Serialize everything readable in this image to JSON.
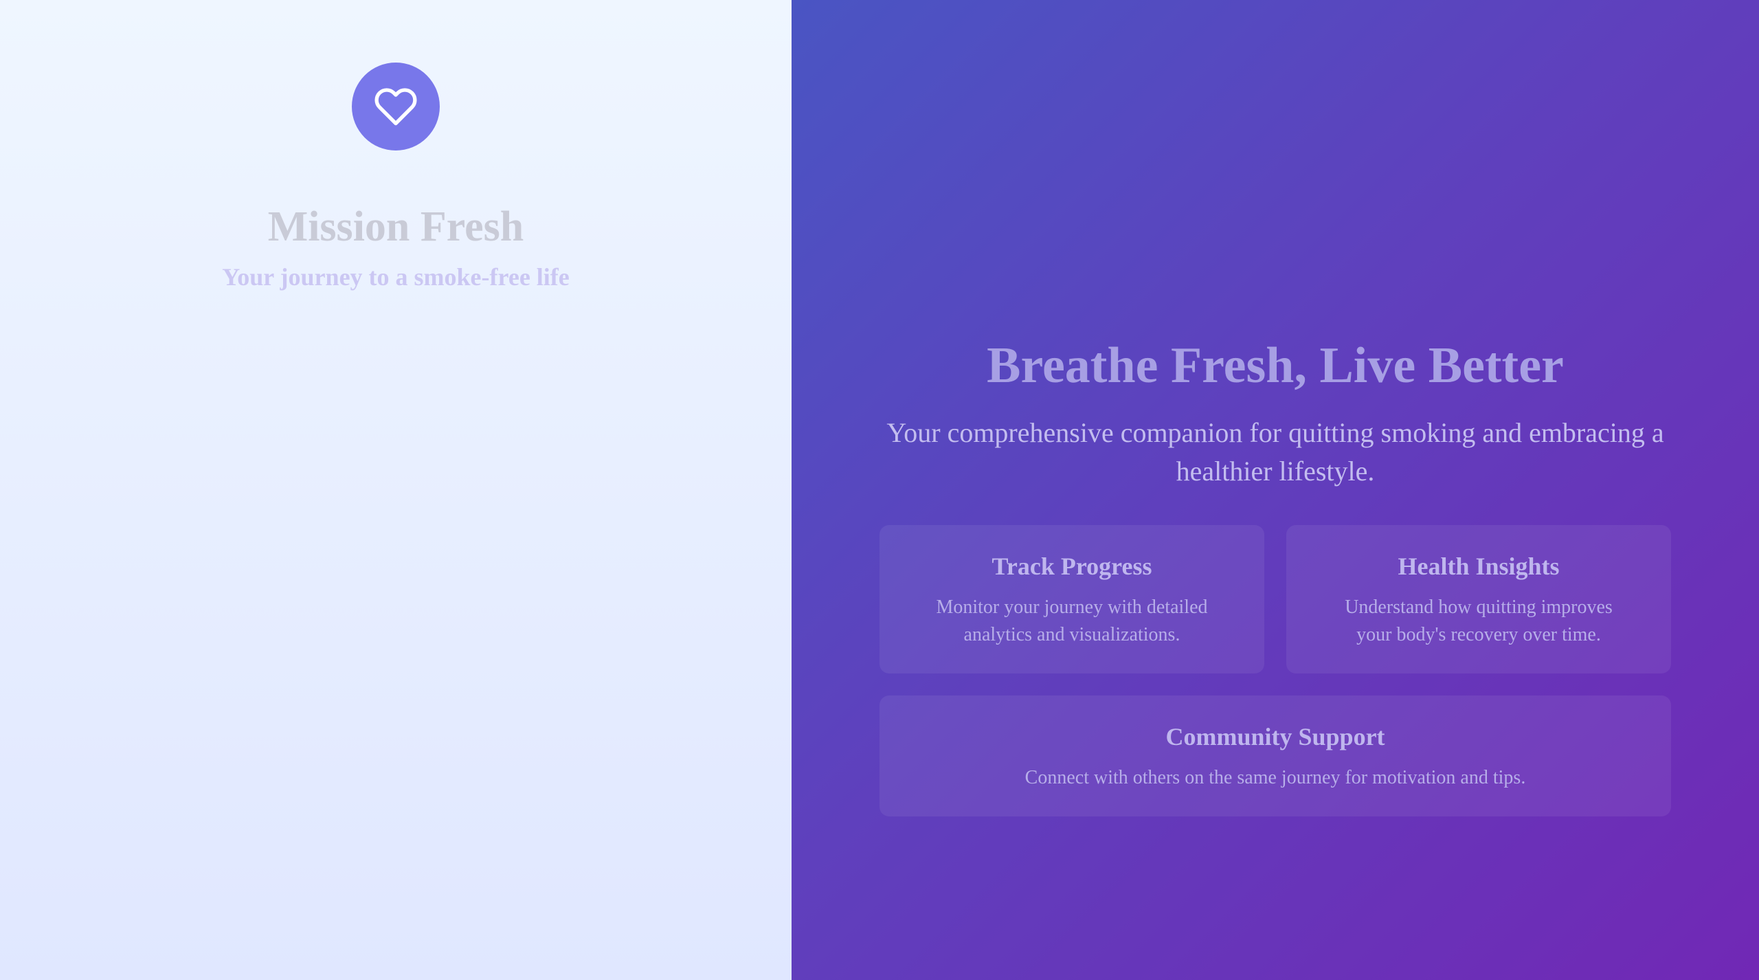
{
  "brand": {
    "logo_icon": "heart-icon",
    "logo_color": "#7877ea",
    "name": "Mission Fresh",
    "tagline": "Your journey to a smoke-free life"
  },
  "hero": {
    "title": "Breathe Fresh, Live Better",
    "subtitle": "Your comprehensive companion for quitting smoking and embracing a healthier lifestyle."
  },
  "features": [
    {
      "title": "Track Progress",
      "description": "Monitor your journey with detailed analytics and visualizations."
    },
    {
      "title": "Health Insights",
      "description": "Understand how quitting improves your body's recovery over time."
    },
    {
      "title": "Community Support",
      "description": "Connect with others on the same journey for motivation and tips."
    }
  ],
  "colors": {
    "left_bg_top": "#eff6ff",
    "left_bg_bottom": "#e0e7ff",
    "right_bg_start": "#4a55c3",
    "right_bg_end": "#7128b5"
  }
}
